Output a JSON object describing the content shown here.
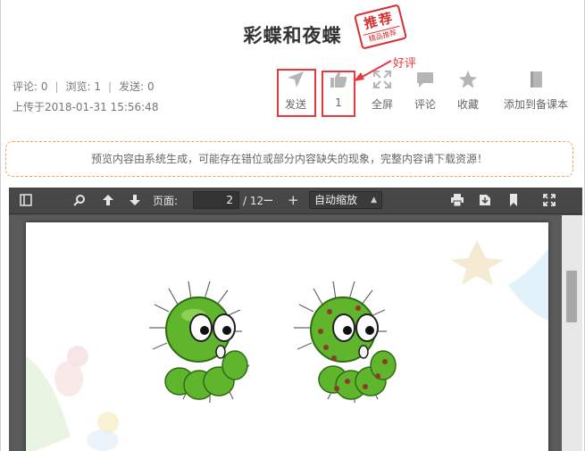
{
  "title": "彩蝶和夜蝶",
  "stamp": {
    "main": "推荐",
    "sub": "精品推荐"
  },
  "meta": {
    "comments": "评论: 0",
    "views": "浏览: 1",
    "sends": "发送: 0",
    "uploaded": "上传于2018-01-31 15:56:48"
  },
  "actions": [
    {
      "label": "发送",
      "icon": "send-icon"
    },
    {
      "label": "1",
      "icon": "thumbs-up-icon"
    },
    {
      "label": "全屏",
      "icon": "fullscreen-icon"
    },
    {
      "label": "评论",
      "icon": "comment-icon"
    },
    {
      "label": "收藏",
      "icon": "star-icon"
    },
    {
      "label": "添加到备课本",
      "icon": "book-icon"
    }
  ],
  "annotation": "好评",
  "notice": "预览内容由系统生成，可能存在错位或部分内容缺失的现象，完整内容请下载资源！",
  "viewer": {
    "page_label": "页面:",
    "page_current": "2",
    "page_total": "/ 12",
    "zoom": "自动缩放"
  },
  "colors": {
    "highlight": "#e8383d",
    "notice_border": "#f0a35a",
    "toolbar": "#474747"
  }
}
